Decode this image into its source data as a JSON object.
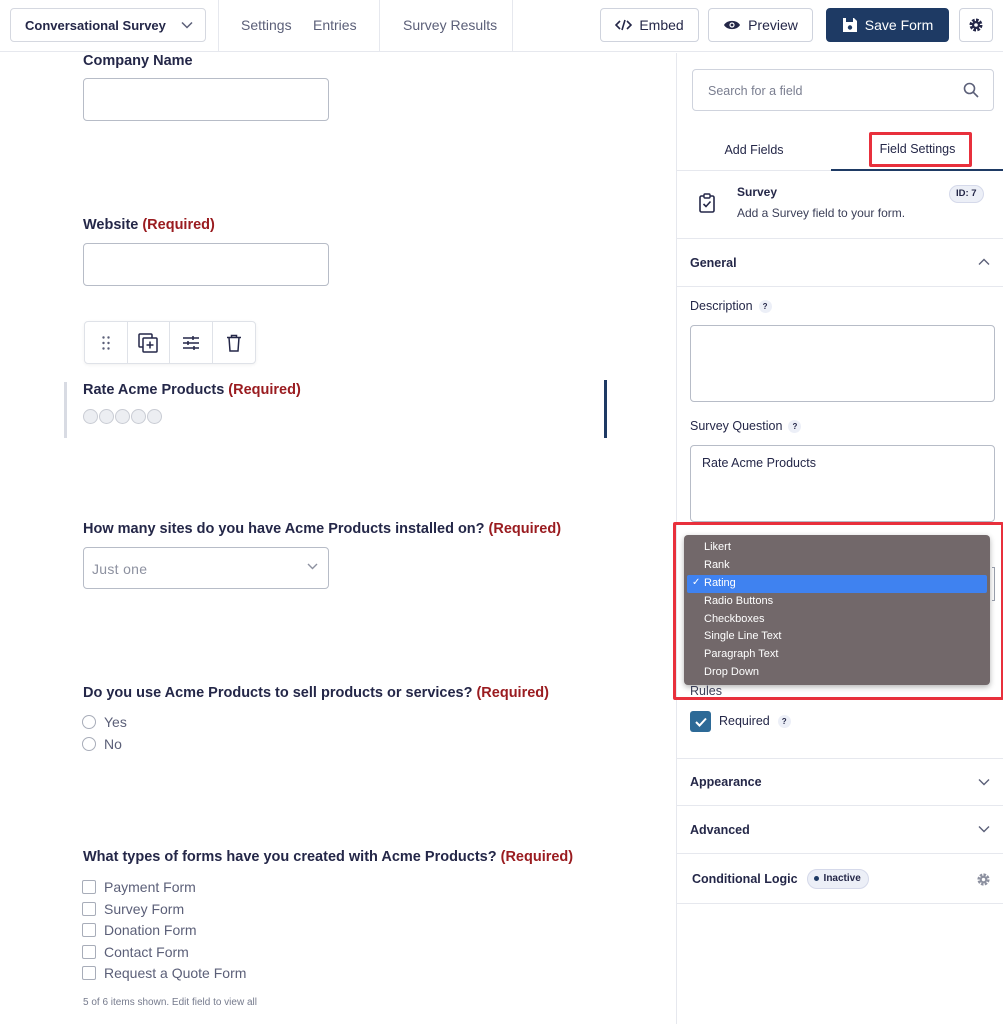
{
  "topbar": {
    "form_name": "Conversational Survey",
    "links": [
      "Settings",
      "Entries",
      "Survey Results"
    ],
    "embed_label": "Embed",
    "preview_label": "Preview",
    "save_label": "Save Form"
  },
  "canvas": {
    "company": {
      "label": "Company Name"
    },
    "website": {
      "label": "Website",
      "required": "(Required)"
    },
    "rate": {
      "label": "Rate Acme Products",
      "required": "(Required)",
      "stars": 5
    },
    "sites": {
      "label": "How many sites do you have Acme Products installed on?",
      "required": "(Required)",
      "selected": "Just one"
    },
    "sell": {
      "label": "Do you use Acme Products to sell products or services?",
      "required": "(Required)",
      "options": [
        "Yes",
        "No"
      ]
    },
    "types": {
      "label": "What types of forms have you created with Acme Products?",
      "required": "(Required)",
      "options": [
        "Payment Form",
        "Survey Form",
        "Donation Form",
        "Contact Form",
        "Request a Quote Form"
      ],
      "note": "5 of 6 items shown. Edit field to view all"
    }
  },
  "sidebar": {
    "search_placeholder": "Search for a field",
    "tabs": [
      "Add Fields",
      "Field Settings"
    ],
    "field": {
      "title": "Survey",
      "desc": "Add a Survey field to your form.",
      "id": "ID: 7"
    },
    "general": "General",
    "description_label": "Description",
    "question_label": "Survey Question",
    "question_value": "Rate Acme Products",
    "type_options": [
      "Likert",
      "Rank",
      "Rating",
      "Radio Buttons",
      "Checkboxes",
      "Single Line Text",
      "Paragraph Text",
      "Drop Down"
    ],
    "type_selected_index": 2,
    "rules_label": "Rules",
    "required_label": "Required",
    "appearance": "Appearance",
    "advanced": "Advanced",
    "conditional": "Conditional Logic",
    "conditional_status": "Inactive"
  },
  "colors": {
    "accent": "#1e3a64",
    "required": "#9a1c20",
    "highlight": "#e8303c",
    "menu_select": "#3f82f0"
  }
}
